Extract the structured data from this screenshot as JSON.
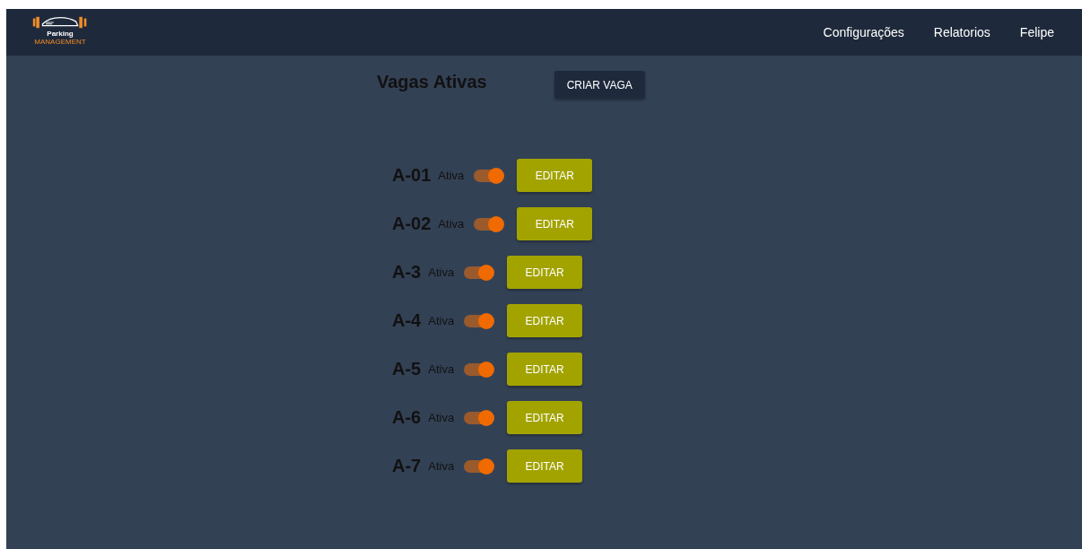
{
  "logo": {
    "line_1": "Parking",
    "line_2": "MANAGEMENT"
  },
  "nav": [
    "Configurações",
    "Relatorios",
    "Felipe"
  ],
  "title": "Vagas Ativas",
  "create_button": "CRIAR VAGA",
  "spots": [
    {
      "name": "A-01",
      "status": "Ativa",
      "on": true,
      "action": "EDITAR"
    },
    {
      "name": "A-02",
      "status": "Ativa",
      "on": true,
      "action": "EDITAR"
    },
    {
      "name": "A-3",
      "status": "Ativa",
      "on": true,
      "action": "EDITAR"
    },
    {
      "name": "A-4",
      "status": "Ativa",
      "on": true,
      "action": "EDITAR"
    },
    {
      "name": "A-5",
      "status": "Ativa",
      "on": true,
      "action": "EDITAR"
    },
    {
      "name": "A-6",
      "status": "Ativa",
      "on": true,
      "action": "EDITAR"
    },
    {
      "name": "A-7",
      "status": "Ativa",
      "on": true,
      "action": "EDITAR"
    }
  ]
}
